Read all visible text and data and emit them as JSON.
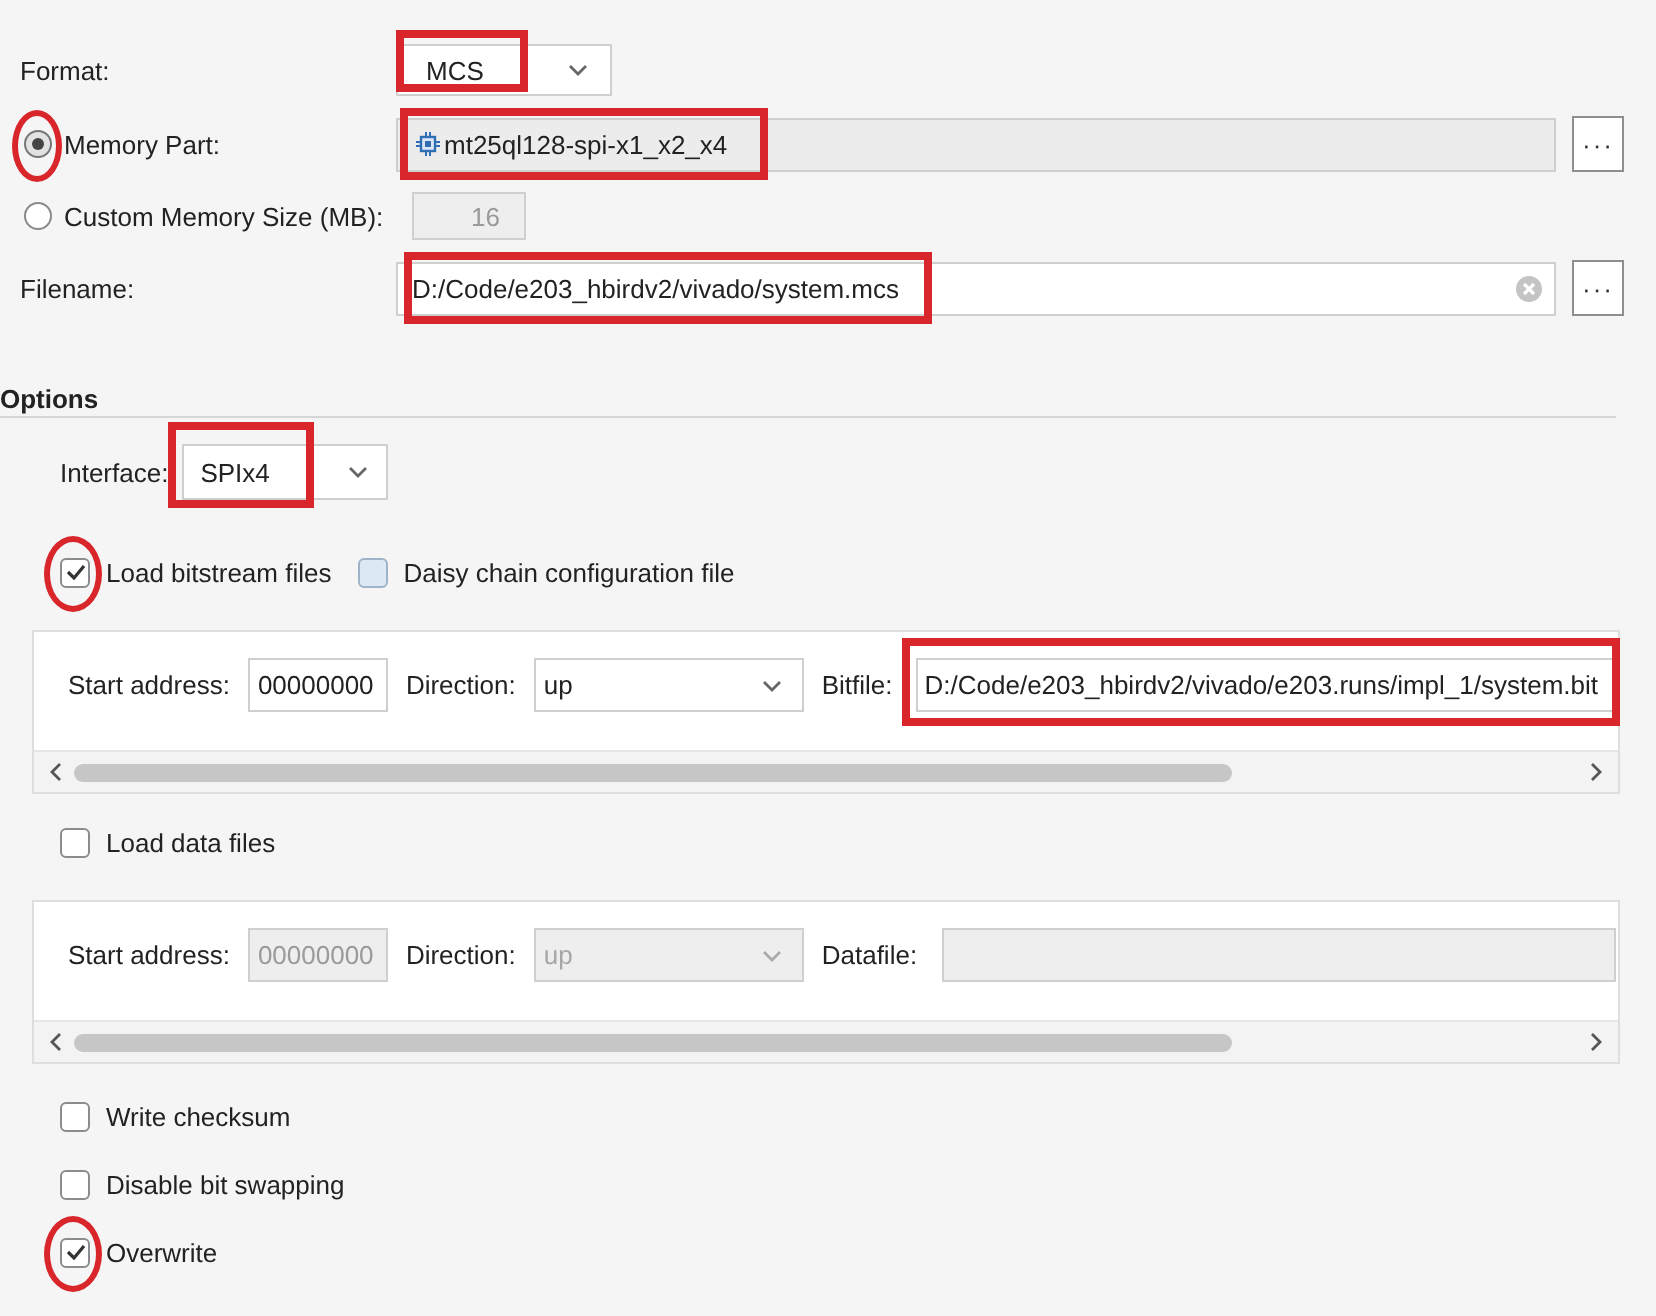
{
  "format": {
    "label": "Format:",
    "value": "MCS",
    "highlighted": true
  },
  "memory": [
    {
      "kind": "part",
      "label": "Memory Part:",
      "selected": true,
      "circled": true,
      "value": "mt25ql128-spi-x1_x2_x4",
      "highlighted": true,
      "button": "···"
    },
    {
      "kind": "size",
      "label": "Custom Memory Size (MB):",
      "selected": false,
      "circled": false,
      "value": "16"
    }
  ],
  "filename": {
    "label": "Filename:",
    "value": "D:/Code/e203_hbirdv2/vivado/system.mcs",
    "highlighted": true,
    "button": "···"
  },
  "options": {
    "title": "Options",
    "interface": {
      "label": "Interface:",
      "value": "SPIx4",
      "highlighted": true
    },
    "groups": [
      {
        "checks": [
          {
            "label": "Load bitstream files",
            "checked": true,
            "circled": true,
            "hover": false
          },
          {
            "label": "Daisy chain configuration file",
            "checked": false,
            "circled": false,
            "hover": true
          }
        ],
        "panel": {
          "disabled": false,
          "start_label": "Start address:",
          "start_value": "00000000",
          "direction_label": "Direction:",
          "direction_value": "up",
          "file_label": "Bitfile:",
          "file_value": "D:/Code/e203_hbirdv2/vivado/e203.runs/impl_1/system.bit",
          "highlighted": true
        }
      },
      {
        "checks": [
          {
            "label": "Load data files",
            "checked": false,
            "circled": false,
            "hover": false
          }
        ],
        "panel": {
          "disabled": true,
          "start_label": "Start address:",
          "start_value": "00000000",
          "direction_label": "Direction:",
          "direction_value": "up",
          "file_label": "Datafile:",
          "highlighted": false
        }
      }
    ],
    "flags": [
      {
        "label": "Write checksum",
        "checked": false,
        "circled": false,
        "hover": false
      },
      {
        "label": "Disable bit swapping",
        "checked": false,
        "circled": false,
        "hover": false
      },
      {
        "label": "Overwrite",
        "checked": true,
        "circled": true,
        "hover": false
      }
    ]
  }
}
